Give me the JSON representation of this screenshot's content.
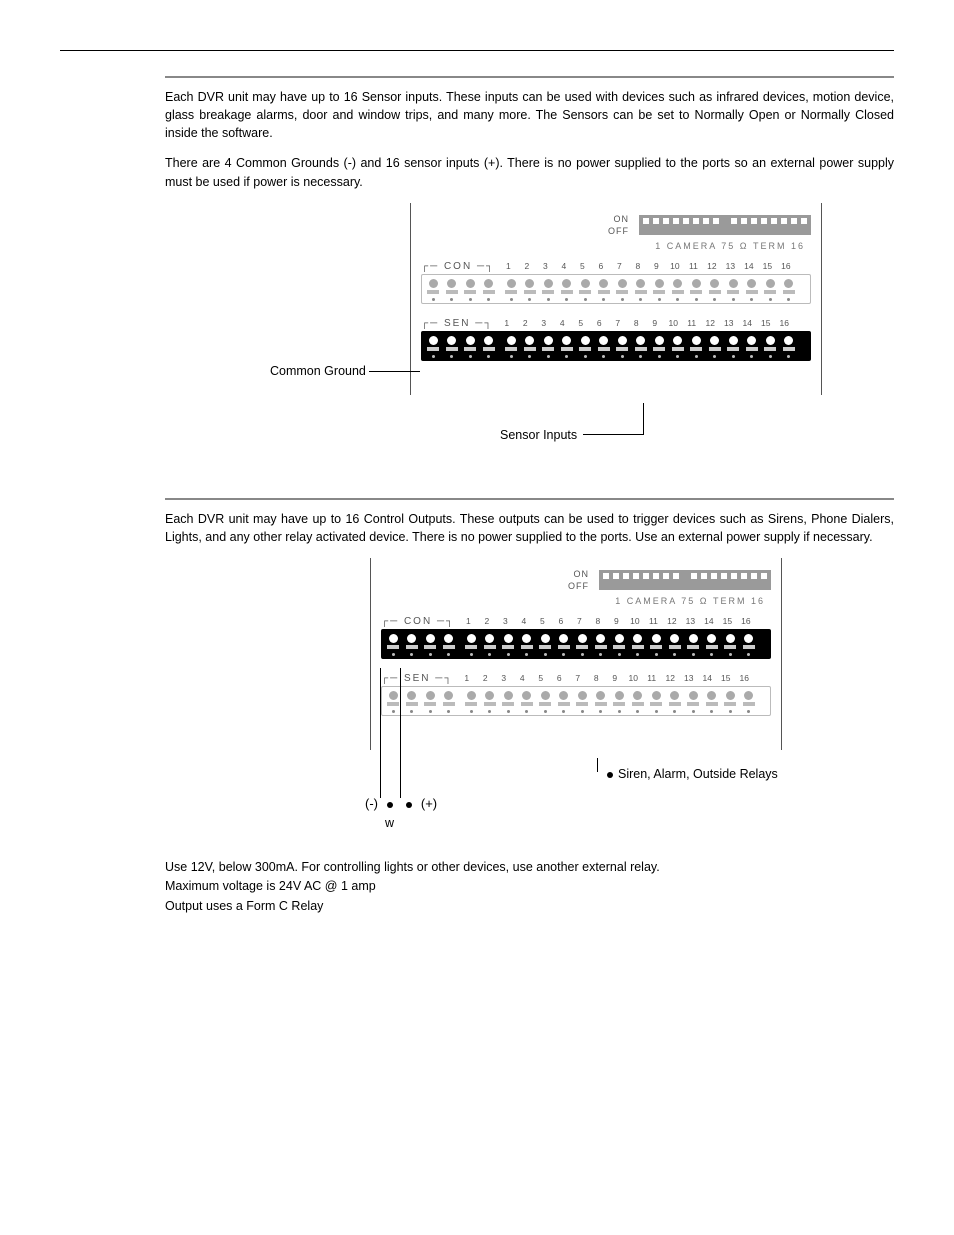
{
  "section1": {
    "para1": "Each DVR unit may have up to 16 Sensor inputs. These inputs can be used with devices such as infrared devices, motion device, glass breakage alarms, door and window trips, and many more. The Sensors can be set to Normally Open or Normally Closed inside the software.",
    "para2": "There are 4 Common Grounds (-) and 16 sensor inputs (+). There is no power supplied to the ports so an external power supply must be used if power is necessary.",
    "dip_on": "ON",
    "dip_off": "OFF",
    "term_label": "1 CAMERA 75 Ω   TERM 16",
    "con_label": "CON",
    "sen_label": "SEN",
    "numbers": [
      "1",
      "2",
      "3",
      "4",
      "5",
      "6",
      "7",
      "8",
      "9",
      "10",
      "11",
      "12",
      "13",
      "14",
      "15",
      "16"
    ],
    "ann_left": "Common Ground",
    "ann_bottom": "Sensor Inputs"
  },
  "section2": {
    "para1": "Each DVR unit may have up to 16 Control Outputs. These outputs can be used to trigger devices such as Sirens, Phone Dialers, Lights, and any other relay activated device.  There is no power supplied to the ports. Use an external power supply if necessary.",
    "dip_on": "ON",
    "dip_off": "OFF",
    "term_label": "1 CAMERA 75 Ω   TERM 16",
    "con_label": "CON",
    "sen_label": "SEN",
    "numbers": [
      "1",
      "2",
      "3",
      "4",
      "5",
      "6",
      "7",
      "8",
      "9",
      "10",
      "11",
      "12",
      "13",
      "14",
      "15",
      "16"
    ],
    "ann_relay": "Siren, Alarm, Outside Relays",
    "neg": "(-)",
    "pos": "(+)",
    "w": "w",
    "spec1": "Use 12V, below 300mA. For controlling lights or other devices, use another external relay.",
    "spec2": "Maximum voltage is 24V AC @ 1 amp",
    "spec3": "Output uses a Form C Relay"
  }
}
